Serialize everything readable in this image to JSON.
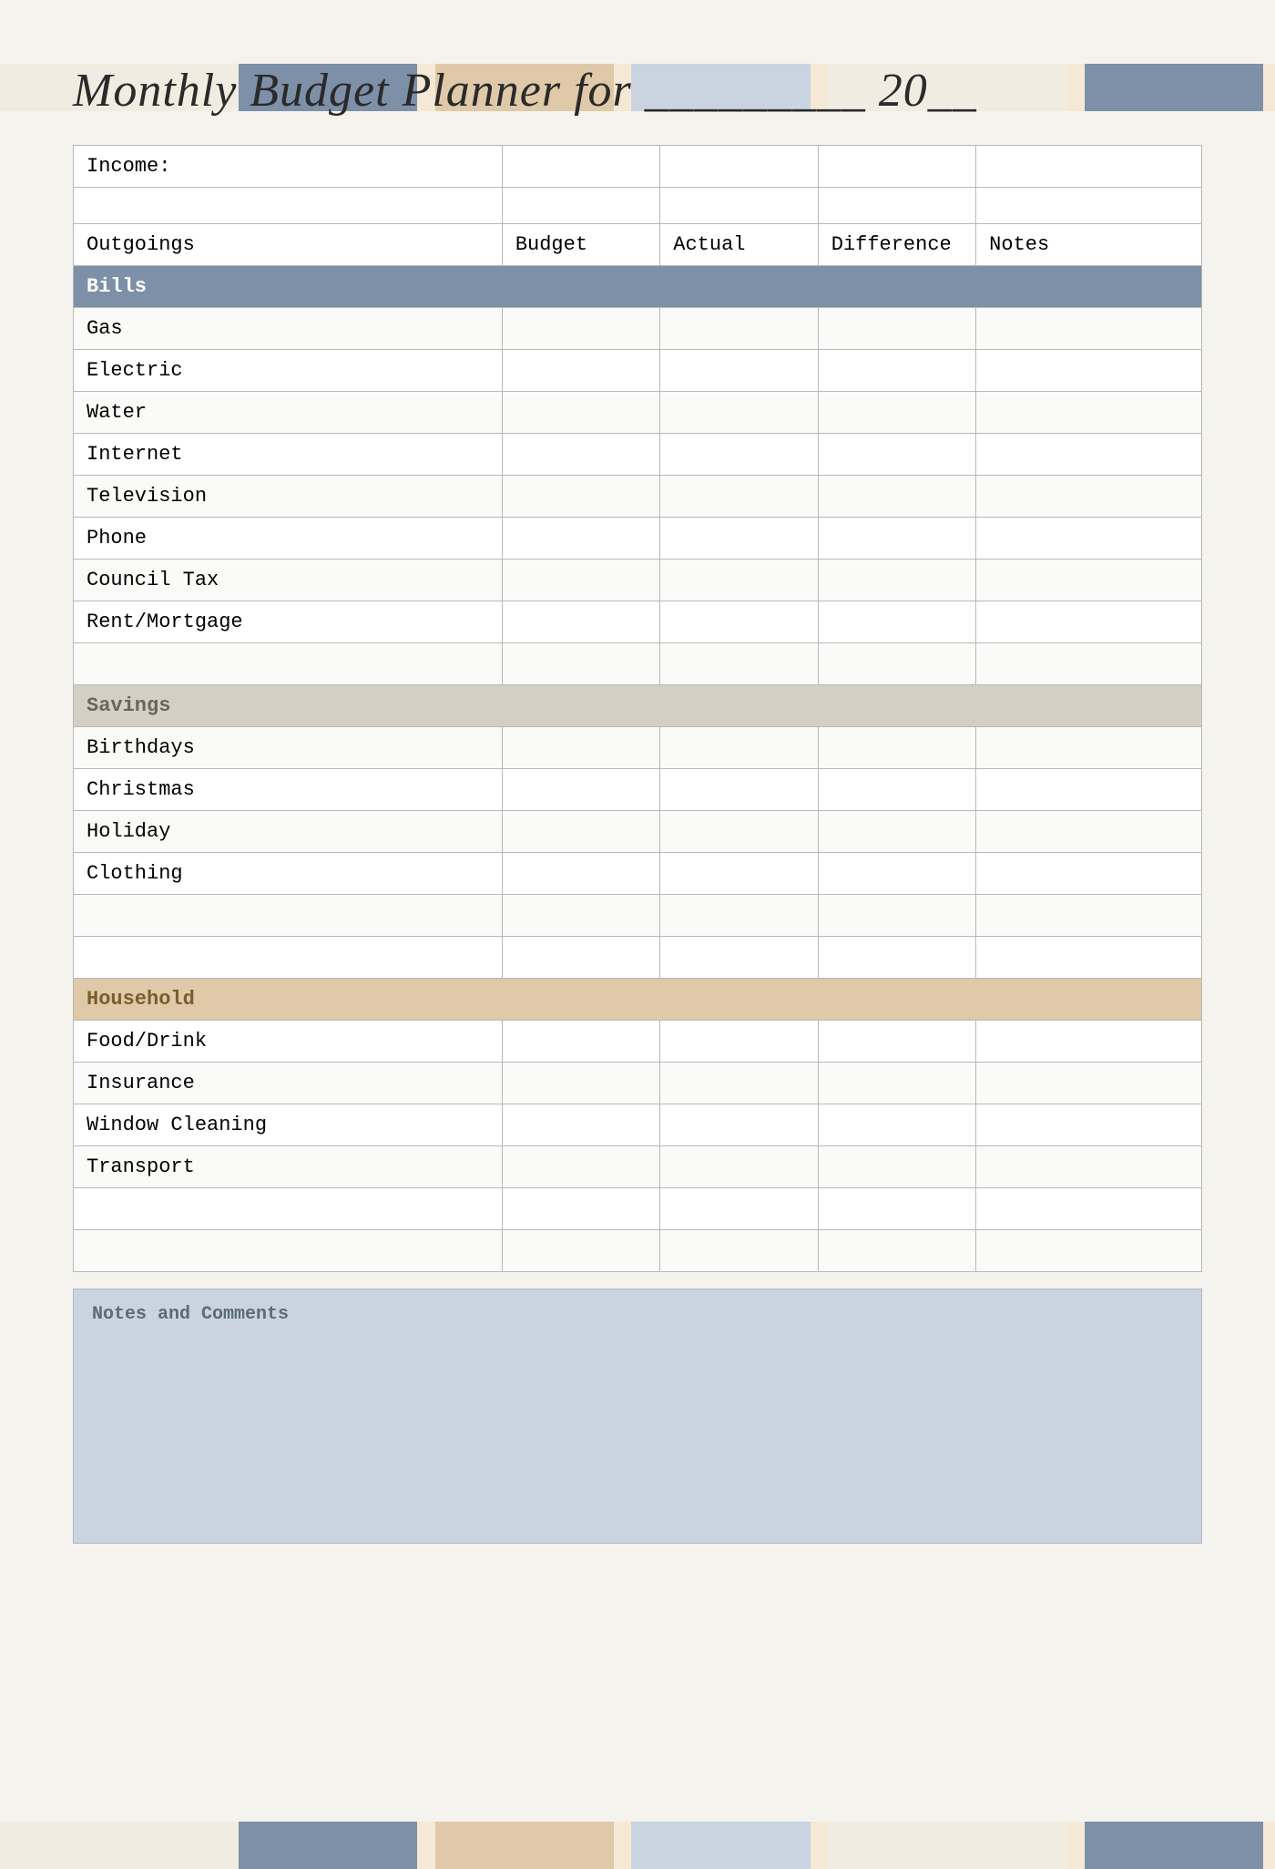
{
  "page": {
    "title": "Monthly Budget Planner for _________ 20__",
    "title_part1": "Monthly Budget Planner for",
    "title_part2": "_________ 20__"
  },
  "deco_top": [
    {
      "color": "#f0ece2",
      "flex": 1
    },
    {
      "color": "#7e90a8",
      "flex": 1.2
    },
    {
      "color": "#f5e9d5",
      "flex": 0.1
    },
    {
      "color": "#dfc9a8",
      "flex": 1.2
    },
    {
      "color": "#f5e9d5",
      "flex": 0.1
    },
    {
      "color": "#c9d4e0",
      "flex": 1.2
    },
    {
      "color": "#f5e9d5",
      "flex": 0.1
    },
    {
      "color": "#f0ece2",
      "flex": 1
    },
    {
      "color": "#f5e9d5",
      "flex": 0.1
    },
    {
      "color": "#7e90a8",
      "flex": 1.2
    },
    {
      "color": "#f5e9d5",
      "flex": 0.05
    }
  ],
  "table": {
    "income_label": "Income:",
    "columns": {
      "outgoings": "Outgoings",
      "budget": "Budget",
      "actual": "Actual",
      "difference": "Difference",
      "notes": "Notes"
    },
    "sections": [
      {
        "id": "bills",
        "label": "Bills",
        "color": "bills",
        "items": [
          "Gas",
          "Electric",
          "Water",
          "Internet",
          "Television",
          "Phone",
          "Council Tax",
          "Rent/Mortgage",
          ""
        ]
      },
      {
        "id": "savings",
        "label": "Savings",
        "color": "savings",
        "items": [
          "Birthdays",
          "Christmas",
          "Holiday",
          "Clothing",
          "",
          ""
        ]
      },
      {
        "id": "household",
        "label": "Household",
        "color": "household",
        "items": [
          "Food/Drink",
          "Insurance",
          "Window Cleaning",
          "Transport",
          "",
          ""
        ]
      }
    ]
  },
  "notes": {
    "label": "Notes and Comments"
  }
}
